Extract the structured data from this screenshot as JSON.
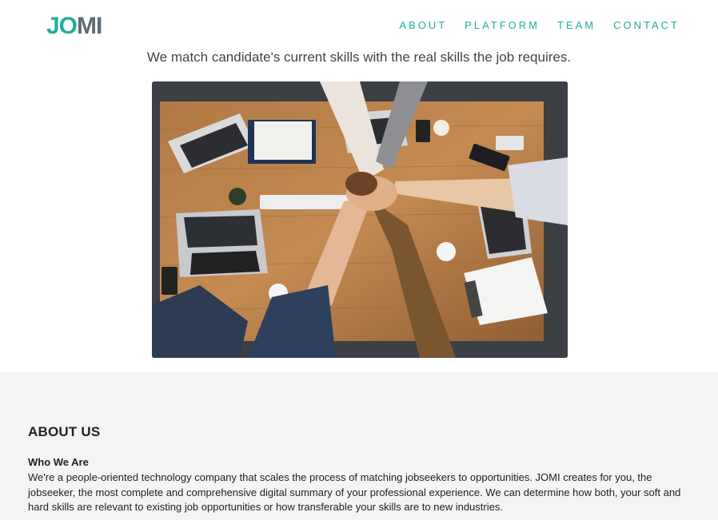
{
  "header": {
    "logo": {
      "part1": "JO",
      "part2": "MI"
    },
    "nav": [
      {
        "label": "ABOUT"
      },
      {
        "label": "PLATFORM"
      },
      {
        "label": "TEAM"
      },
      {
        "label": "CONTACT"
      }
    ]
  },
  "hero": {
    "tagline": "We match candidate's current skills with the real skills the job requires."
  },
  "about": {
    "heading": "ABOUT US",
    "subheading": "Who We Are",
    "body": "We're a people-oriented technology company that scales the process of matching jobseekers to opportunities. JOMI creates for you, the jobseeker, the most complete and comprehensive digital summary of your professional experience. We can determine how both, your soft and hard skills are relevant to existing job opportunities or how transferable your skills are to new industries."
  },
  "colors": {
    "brand": "#1fae9b",
    "logo_secondary": "#5e6b73",
    "section_bg": "#f4f4f4"
  }
}
